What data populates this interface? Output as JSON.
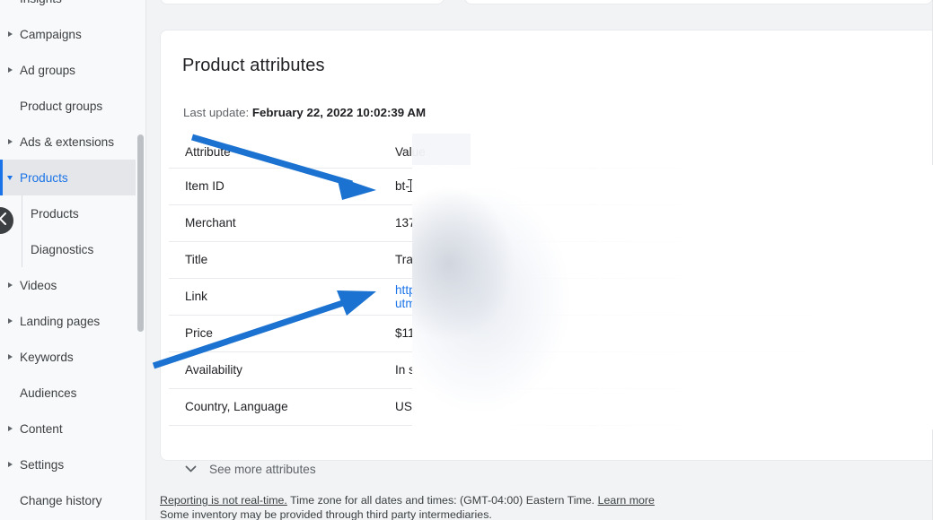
{
  "sidebar": {
    "items": [
      {
        "label": "Insights",
        "expandable": false,
        "indent": false,
        "selected": false
      },
      {
        "label": "Campaigns",
        "expandable": true,
        "indent": false,
        "selected": false
      },
      {
        "label": "Ad groups",
        "expandable": true,
        "indent": false,
        "selected": false
      },
      {
        "label": "Product groups",
        "expandable": false,
        "indent": false,
        "selected": false
      },
      {
        "label": "Ads & extensions",
        "expandable": true,
        "indent": false,
        "selected": false
      },
      {
        "label": "Products",
        "expandable": true,
        "indent": false,
        "selected": true
      },
      {
        "label": "Videos",
        "expandable": true,
        "indent": false,
        "selected": false
      },
      {
        "label": "Landing pages",
        "expandable": true,
        "indent": false,
        "selected": false
      },
      {
        "label": "Keywords",
        "expandable": true,
        "indent": false,
        "selected": false
      },
      {
        "label": "Audiences",
        "expandable": false,
        "indent": false,
        "selected": false
      },
      {
        "label": "Content",
        "expandable": true,
        "indent": false,
        "selected": false
      },
      {
        "label": "Settings",
        "expandable": true,
        "indent": false,
        "selected": false
      },
      {
        "label": "Change history",
        "expandable": false,
        "indent": false,
        "selected": false
      }
    ],
    "children": [
      {
        "label": "Products"
      },
      {
        "label": "Diagnostics"
      }
    ],
    "collapse_icon": "chevron-left-icon",
    "selected_color": "#1a73e8"
  },
  "card": {
    "title": "Product attributes",
    "last_update_label": "Last update:",
    "last_update_value": "February 22, 2022 10:02:39 AM",
    "see_more_label": "See more attributes",
    "see_more_icon": "chevron-down-icon"
  },
  "table": {
    "headers": [
      "Attribute",
      "Value"
    ],
    "rows": [
      {
        "attribute": "Item ID",
        "value": "bt-",
        "cursor": true,
        "is_link": false
      },
      {
        "attribute": "Merchant",
        "value": "137",
        "cursor": false,
        "is_link": false
      },
      {
        "attribute": "Title",
        "value": "Tra",
        "cursor": false,
        "is_link": false
      },
      {
        "attribute": "Link",
        "value": "http",
        "value_line2": "utm",
        "cursor": false,
        "is_link": true
      },
      {
        "attribute": "Price",
        "value": "$11",
        "cursor": false,
        "is_link": false
      },
      {
        "attribute": "Availability",
        "value": "In s",
        "cursor": false,
        "is_link": false
      },
      {
        "attribute": "Country, Language",
        "value": "US,",
        "cursor": false,
        "is_link": false
      }
    ]
  },
  "footer": {
    "link_reporting": "Reporting is not real-time.",
    "text_timezone": " Time zone for all dates and times: (GMT-04:00) Eastern Time. ",
    "link_learn_more": "Learn more",
    "line2": "Some inventory may be provided through third party intermediaries."
  },
  "annotations": {
    "arrow_color": "#1b72d0",
    "arrow1_label": "arrow-pointing-to-item-id-value",
    "arrow2_label": "arrow-pointing-to-link-value"
  }
}
